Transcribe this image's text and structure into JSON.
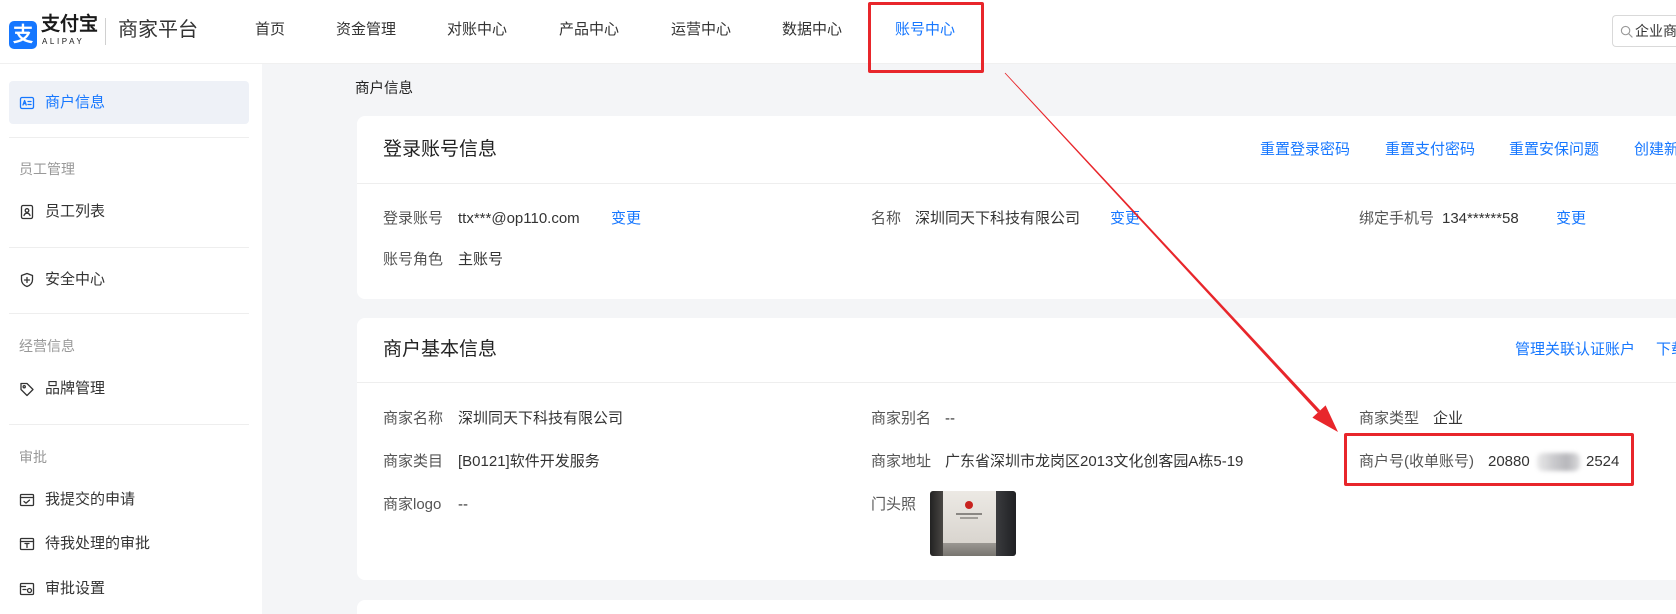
{
  "header": {
    "logo_mark": "支",
    "logo_text": "支付宝",
    "logo_sub": "ALIPAY",
    "platform_name": "商家平台",
    "nav": [
      {
        "label": "首页"
      },
      {
        "label": "资金管理"
      },
      {
        "label": "对账中心"
      },
      {
        "label": "产品中心"
      },
      {
        "label": "运营中心"
      },
      {
        "label": "数据中心"
      },
      {
        "label": "账号中心",
        "active": true
      }
    ],
    "search": {
      "icon": "search-icon",
      "value": "企业商"
    }
  },
  "sidebar": {
    "merchant_info": {
      "label": "商户信息",
      "icon": "id-card-icon"
    },
    "staff_section": "员工管理",
    "staff_list": {
      "label": "员工列表",
      "icon": "staff-list-icon"
    },
    "security_center": {
      "label": "安全中心",
      "icon": "shield-icon"
    },
    "business_section": "经营信息",
    "brand_management": {
      "label": "品牌管理",
      "icon": "tag-icon"
    },
    "approval_section": "审批",
    "my_requests": {
      "label": "我提交的申请",
      "icon": "submitted-request-icon"
    },
    "pending_approvals": {
      "label": "待我处理的审批",
      "icon": "pending-approval-icon"
    },
    "approval_settings": {
      "label": "审批设置",
      "icon": "approval-settings-icon"
    }
  },
  "main": {
    "page_title": "商户信息",
    "login_card": {
      "title": "登录账号信息",
      "actions": [
        "重置登录密码",
        "重置支付密码",
        "重置安保问题",
        "创建新"
      ],
      "login_account": {
        "label": "登录账号",
        "value": "ttx***@op110.com",
        "link": "变更"
      },
      "name": {
        "label": "名称",
        "value": "深圳同天下科技有限公司",
        "link": "变更"
      },
      "phone": {
        "label": "绑定手机号",
        "value": "134******58",
        "link": "变更"
      },
      "role": {
        "label": "账号角色",
        "value": "主账号"
      }
    },
    "merchant_card": {
      "title": "商户基本信息",
      "actions": [
        "管理关联认证账户",
        "下载"
      ],
      "merchant_name": {
        "label": "商家名称",
        "value": "深圳同天下科技有限公司"
      },
      "alias": {
        "label": "商家别名",
        "value": "--"
      },
      "merchant_type": {
        "label": "商家类型",
        "value": "企业"
      },
      "category": {
        "label": "商家类目",
        "value": "[B0121]软件开发服务"
      },
      "address": {
        "label": "商家地址",
        "value": "广东省深圳市龙岗区2013文化创客园A栋5-19"
      },
      "merchant_no": {
        "label": "商户号(收单账号)",
        "value_start": "20880",
        "value_end": "2524"
      },
      "logo": {
        "label": "商家logo",
        "value": "--"
      },
      "storefront": {
        "label": "门头照"
      }
    }
  },
  "colors": {
    "accent": "#1677ff",
    "annotation": "#e8262b",
    "page_bg": "#f4f5f7",
    "selected_bg": "#eef1f7"
  }
}
